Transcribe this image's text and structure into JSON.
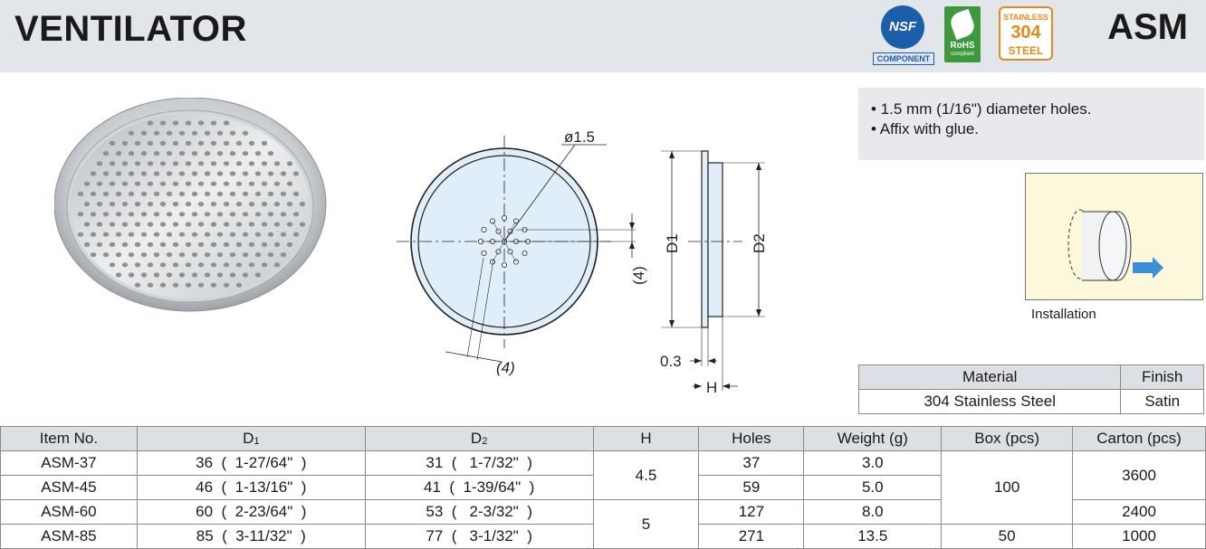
{
  "header": {
    "title": "VENTILATOR",
    "model": "ASM",
    "badges": {
      "nsf": "NSF",
      "nsf_label": "COMPONENT",
      "rohs": "RoHS",
      "rohs_sub": "compliant",
      "steel_top": "STAINLESS",
      "steel_num": "304",
      "steel_bottom": "STEEL"
    }
  },
  "drawing": {
    "hole_dia": "ø1.5",
    "pitch_v": "(4)",
    "pitch_d": "(4)",
    "d1": "D1",
    "d2": "D2",
    "thickness": "0.3",
    "h": "H"
  },
  "notes": [
    "• 1.5 mm (1/16\") diameter holes.",
    "• Affix with glue."
  ],
  "installation_label": "Installation",
  "material_table": {
    "headers": [
      "Material",
      "Finish"
    ],
    "row": [
      "304 Stainless Steel",
      "Satin"
    ]
  },
  "spec_table": {
    "headers": [
      "Item No.",
      "D",
      "D",
      "H",
      "Holes",
      "Weight (g)",
      "Box (pcs)",
      "Carton (pcs)"
    ],
    "header_subs": [
      "1",
      "2"
    ],
    "rows": [
      {
        "item": "ASM-37",
        "d1": "36  (  1-27/64\"  )",
        "d2": "31  (   1-7/32\"  )",
        "holes": "37",
        "weight": "3.0"
      },
      {
        "item": "ASM-45",
        "d1": "46  (  1-13/16\"  )",
        "d2": "41  (  1-39/64\"  )",
        "holes": "59",
        "weight": "5.0"
      },
      {
        "item": "ASM-60",
        "d1": "60  (  2-23/64\"  )",
        "d2": "53  (   2-3/32\"  )",
        "holes": "127",
        "weight": "8.0"
      },
      {
        "item": "ASM-85",
        "d1": "85  (  3-11/32\"  )",
        "d2": "77  (   3-1/32\"  )",
        "holes": "271",
        "weight": "13.5"
      }
    ],
    "h_values": [
      "4.5",
      "5"
    ],
    "box_values": [
      "100",
      "50"
    ],
    "carton_values": [
      "3600",
      "2400",
      "1000"
    ]
  }
}
